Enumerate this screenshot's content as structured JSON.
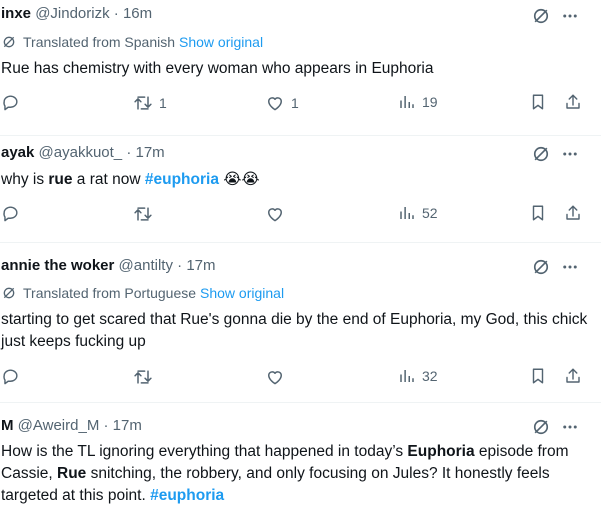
{
  "translated_label": "Translated from",
  "show_original": "Show original",
  "tweets": [
    {
      "name": "inxe",
      "handle": "@Jindorizk",
      "sep": "·",
      "time": "16m",
      "translated_from": "Spanish",
      "text": "Rue has chemistry with every woman who appears in Euphoria",
      "retweets": "1",
      "likes": "1",
      "views": "19"
    },
    {
      "name": "ayak",
      "handle": "@ayakkuot_",
      "sep": "·",
      "time": "17m",
      "text_parts": [
        "why is ",
        "rue",
        " a rat now ",
        "#euphoria",
        " 😭😭"
      ],
      "views": "52"
    },
    {
      "name": "annie the woker",
      "handle": "@antilty",
      "sep": "·",
      "time": "17m",
      "translated_from": "Portuguese",
      "text": "starting to get scared that Rue's gonna die by the end of Euphoria, my God, this chick just keeps fucking up",
      "views": "32"
    },
    {
      "name": "M",
      "handle": "@Aweird_M",
      "sep": "·",
      "time": "17m",
      "text_parts": [
        "How is the TL ignoring everything that happened in today’s ",
        "Euphoria",
        " episode from Cassie, ",
        "Rue",
        " snitching, the robbery, and only focusing on Jules? It honestly feels targeted at this point. ",
        "#euphoria"
      ]
    }
  ],
  "colors": {
    "text": "#0f1419",
    "muted": "#536471",
    "link": "#1d9bf0",
    "divider": "#eff3f4"
  },
  "icons": [
    "not-interested-icon",
    "more-icon",
    "translate-icon",
    "reply-icon",
    "retweet-icon",
    "like-icon",
    "views-icon",
    "bookmark-icon",
    "share-icon"
  ]
}
